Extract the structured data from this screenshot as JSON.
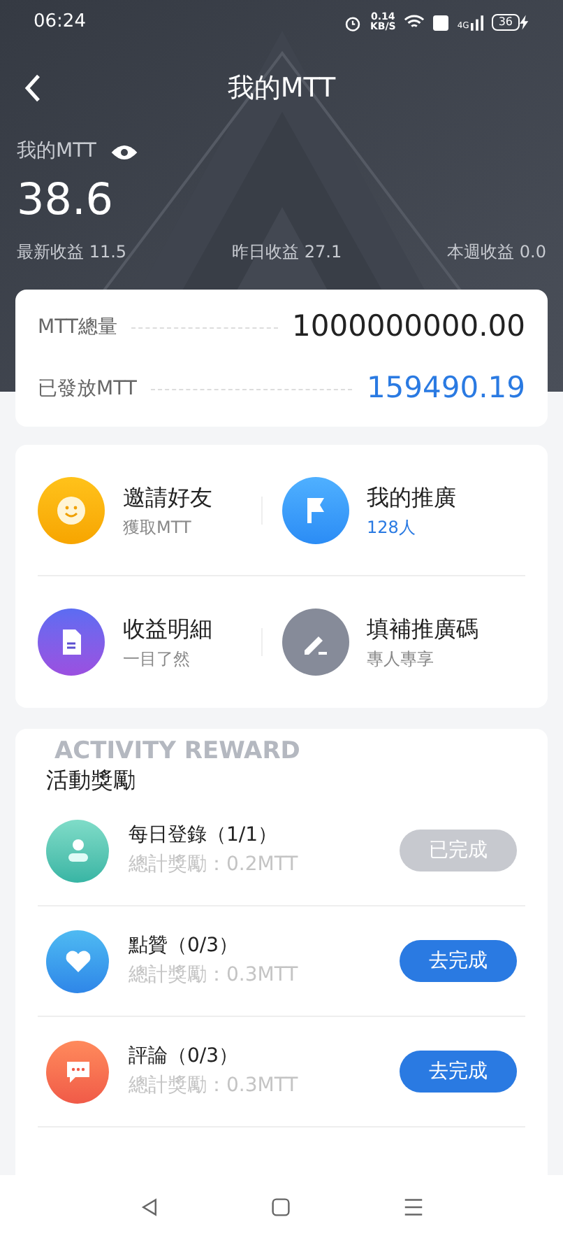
{
  "status_bar": {
    "time": "06:24",
    "speed_value": "0.14",
    "speed_unit": "KB/S",
    "network": "4G",
    "battery": "36"
  },
  "header": {
    "title": "我的MTT",
    "balance_label": "我的MTT",
    "balance": "38.6",
    "stats": [
      {
        "label": "最新收益",
        "value": "11.5"
      },
      {
        "label": "昨日收益",
        "value": "27.1"
      },
      {
        "label": "本週收益",
        "value": "0.0"
      }
    ]
  },
  "supply": [
    {
      "label": "MTT總量",
      "value": "1000000000.00",
      "highlight": false
    },
    {
      "label": "已發放MTT",
      "value": "159490.19",
      "highlight": true
    }
  ],
  "shortcuts": [
    {
      "kind": "smile",
      "title": "邀請好友",
      "subtitle": "獲取MTT",
      "highlight": false
    },
    {
      "kind": "flag",
      "title": "我的推廣",
      "subtitle": "128人",
      "highlight": true
    },
    {
      "kind": "document",
      "title": "收益明細",
      "subtitle": "一目了然",
      "highlight": false
    },
    {
      "kind": "pen",
      "title": "填補推廣碼",
      "subtitle": "專人專享",
      "highlight": false
    }
  ],
  "activity": {
    "watermark": "ACTIVITY REWARD",
    "title": "活動獎勵",
    "tasks": [
      {
        "kind": "person",
        "title": "每日登錄（1/1）",
        "reward": "總計獎勵：0.2MTT",
        "button": "已完成",
        "done": true
      },
      {
        "kind": "heart",
        "title": "點贊（0/3）",
        "reward": "總計獎勵：0.3MTT",
        "button": "去完成",
        "done": false
      },
      {
        "kind": "chat",
        "title": "評論（0/3）",
        "reward": "總計獎勵：0.3MTT",
        "button": "去完成",
        "done": false
      }
    ]
  }
}
